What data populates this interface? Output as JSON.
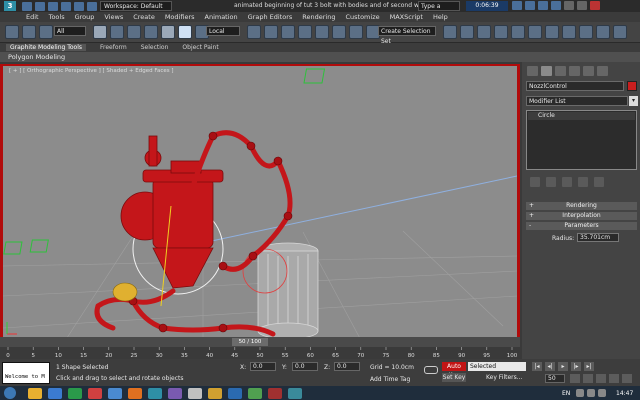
{
  "titlebar": {
    "logo": "3",
    "workspace": "Workspace: Default",
    "document_title": "animated beginning of tut 3 bolt with bodies and of second week.max",
    "search_placeholder": "Type a",
    "time": "0:06:39"
  },
  "menu": [
    "Edit",
    "Tools",
    "Group",
    "Views",
    "Create",
    "Modifiers",
    "Animation",
    "Graph Editors",
    "Rendering",
    "Customize",
    "MAXScript",
    "Help"
  ],
  "toolbar": {
    "selection_filter": "All",
    "reference_coord": "Local",
    "named_selection": "Create Selection Set"
  },
  "ribbon": {
    "tabs": [
      "Graphite Modeling Tools",
      "Freeform",
      "Selection",
      "Object Paint"
    ],
    "panel_label": "Polygon Modeling"
  },
  "viewport": {
    "label": "[ + ] [ Orthographic Perspective ] [ Shaded + Edged Faces ]"
  },
  "command_panel": {
    "object_name": "NozzlControl",
    "object_color": "#c81e1e",
    "modifier_list": "Modifier List",
    "stack_item": "Circle",
    "rollouts": [
      {
        "sign": "+",
        "label": "Rendering"
      },
      {
        "sign": "+",
        "label": "Interpolation"
      },
      {
        "sign": "-",
        "label": "Parameters"
      }
    ],
    "radius_label": "Radius:",
    "radius_value": "35.701cm"
  },
  "time_slider": {
    "indicator": "50 / 100",
    "ticks": [
      "0",
      "5",
      "10",
      "15",
      "20",
      "25",
      "30",
      "35",
      "40",
      "45",
      "50",
      "55",
      "60",
      "65",
      "70",
      "75",
      "80",
      "85",
      "90",
      "95",
      "100"
    ]
  },
  "status": {
    "maxscript_text": "Welcome to M",
    "selection": "1 Shape Selected",
    "prompt": "Click and drag to select and rotate objects",
    "x_label": "X:",
    "x_value": "0.0",
    "y_label": "Y:",
    "y_value": "0.0",
    "z_label": "Z:",
    "z_value": "0.0",
    "grid": "Grid = 10.0cm",
    "add_time_tag": "Add Time Tag",
    "auto_key": "Auto Key",
    "set_key": "Set Key",
    "key_selection": "Selected",
    "key_filters": "Key Filters...",
    "frame": "50"
  },
  "taskbar": {
    "language": "EN",
    "clock": "14:47"
  },
  "colors": {
    "viewport_frame": "#b10b0b",
    "model": "#c4161a",
    "auto_key": "#c21414"
  }
}
